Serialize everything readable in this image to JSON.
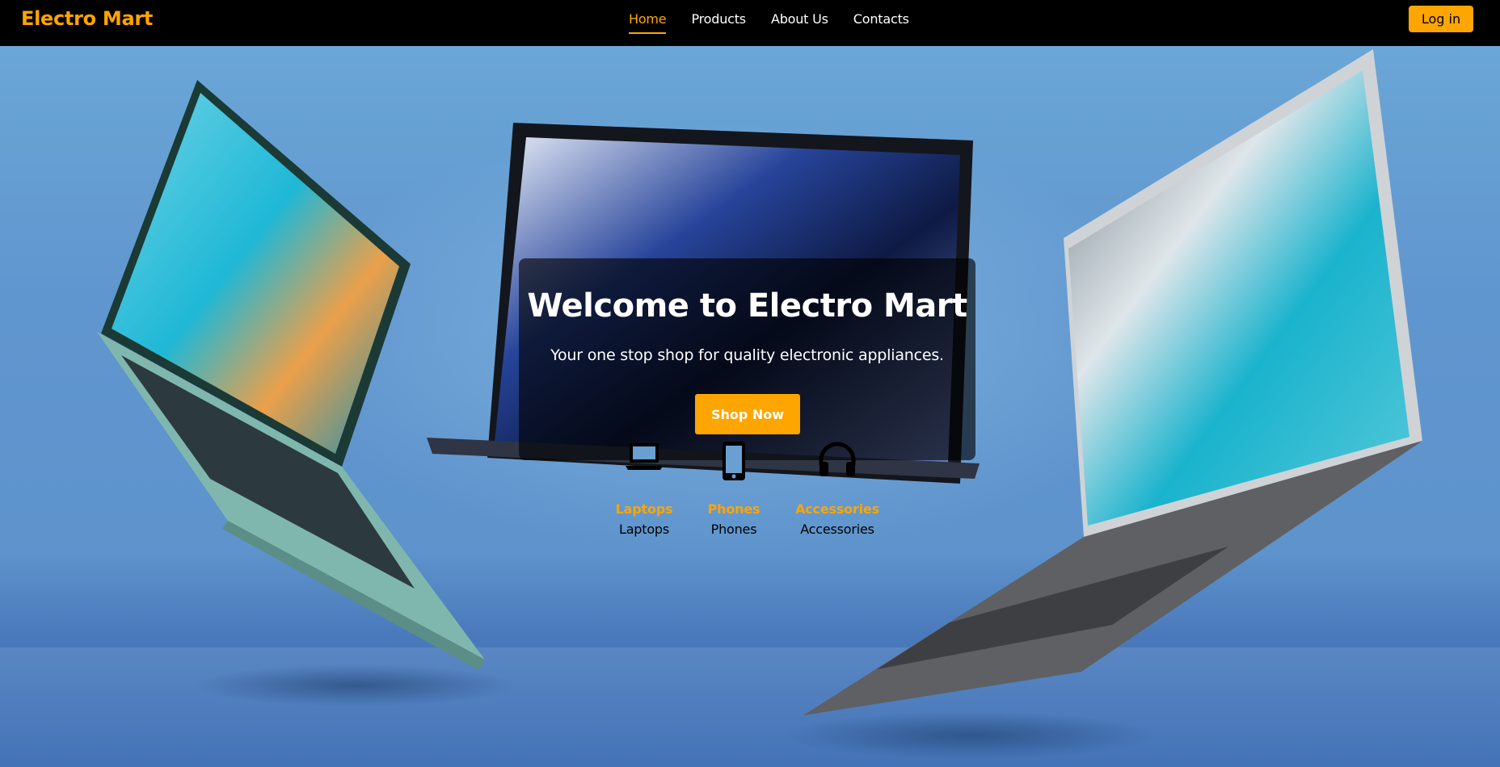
{
  "brand": {
    "name": "Electro Mart"
  },
  "nav": {
    "items": [
      {
        "label": "Home",
        "active": true
      },
      {
        "label": "Products",
        "active": false
      },
      {
        "label": "About Us",
        "active": false
      },
      {
        "label": "Contacts",
        "active": false
      }
    ],
    "login_label": "Log in"
  },
  "hero": {
    "title": "Welcome to Electro Mart",
    "subtitle": "Your one stop shop for quality electronic appliances.",
    "cta_label": "Shop Now"
  },
  "categories": [
    {
      "icon": "laptop-icon",
      "title": "Laptops",
      "label": "Laptops"
    },
    {
      "icon": "phone-icon",
      "title": "Phones",
      "label": "Phones"
    },
    {
      "icon": "headphones-icon",
      "title": "Accessories",
      "label": "Accessories"
    }
  ],
  "colors": {
    "accent": "#ffa500",
    "navbar_bg": "#000000",
    "hero_bg": "#5e93cc",
    "overlay_bg": "rgba(0,0,0,0.62)"
  }
}
